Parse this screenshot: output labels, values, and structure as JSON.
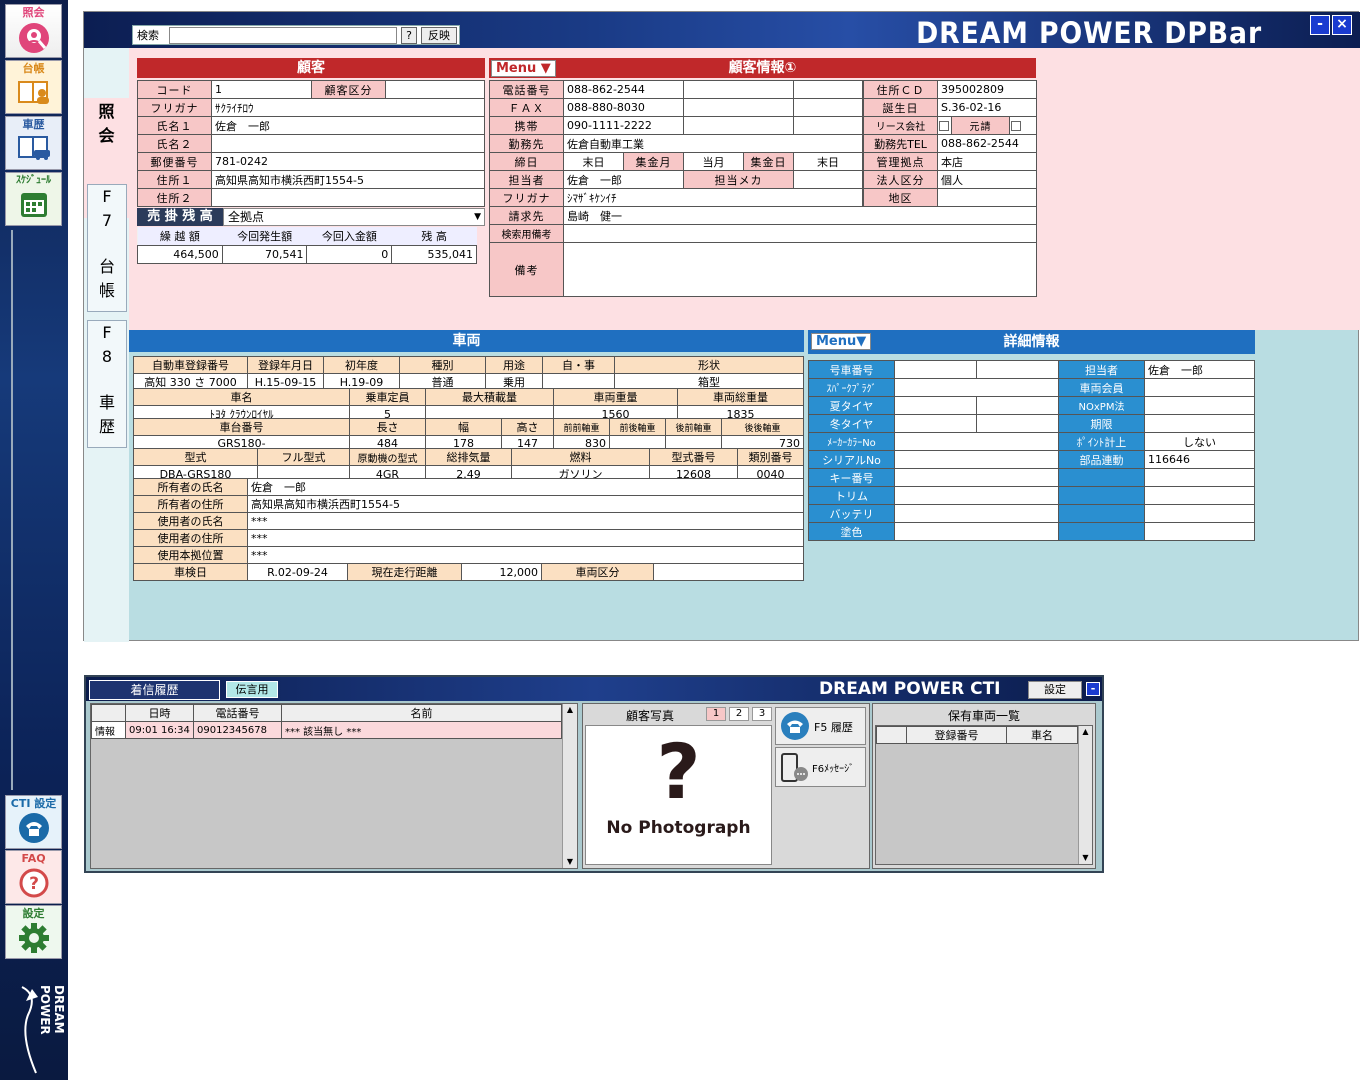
{
  "sidebar": {
    "items": [
      {
        "label": "照会"
      },
      {
        "label": "台帳"
      },
      {
        "label": "車歴"
      },
      {
        "label": "ｽｹｼﾞｭｰﾙ"
      }
    ],
    "bottom": [
      {
        "label": "CTI 設定"
      },
      {
        "label": "FAQ"
      },
      {
        "label": "設定"
      }
    ],
    "brand": "DREAM POWER"
  },
  "window": {
    "title": "DREAM POWER DPBar",
    "search_label": "検索",
    "search_value": "",
    "help_btn": "?",
    "apply_btn": "反映",
    "min_btn": "-",
    "close_btn": "×"
  },
  "tabs": {
    "current": "照会",
    "f7": "F",
    "f7b": "7",
    "f7c": "台",
    "f7d": "帳",
    "f8": "F",
    "f8b": "8",
    "f8c": "車",
    "f8d": "歴",
    "cur1": "照",
    "cur2": "会"
  },
  "customer": {
    "title": "顧客",
    "code_lbl": "コード",
    "code": "1",
    "kubun_lbl": "顧客区分",
    "kubun": "",
    "kana_lbl": "フリガナ",
    "kana": "ｻｸﾗｲﾁﾛｳ",
    "name1_lbl": "氏名１",
    "name1": "佐倉　一郎",
    "name2_lbl": "氏名２",
    "name2": "",
    "zip_lbl": "郵便番号",
    "zip": "781-0242",
    "addr1_lbl": "住所１",
    "addr1": "高知県高知市横浜西町1554-5",
    "addr2_lbl": "住所２",
    "addr2": "",
    "balance_lbl": "売 掛 残 高",
    "balance_scope": "全拠点",
    "carry_lbl": "繰 越 額",
    "cur_lbl": "今回発生額",
    "paid_lbl": "今回入金額",
    "rem_lbl": "残 高",
    "carry": "464,500",
    "cur": "70,541",
    "paid": "0",
    "rem": "535,041"
  },
  "custinfo": {
    "menu": "Menu ▼",
    "title": "顧客情報①",
    "tel_lbl": "電話番号",
    "tel": "088-862-2544",
    "fax_lbl": "ＦＡＸ",
    "fax": "088-880-8030",
    "mobile_lbl": "携帯",
    "mobile": "090-1111-2222",
    "work_lbl": "勤務先",
    "work": "佐倉自動車工業",
    "close_lbl": "締日",
    "close": "末日",
    "collect_m_lbl": "集金月",
    "collect_m": "当月",
    "collect_d_lbl": "集金日",
    "collect_d": "末日",
    "staff_lbl": "担当者",
    "staff": "佐倉　一郎",
    "staff_mk_lbl": "担当メカ",
    "staff_mk": "",
    "kana_lbl": "フリガナ",
    "kana": "ｼﾏｻﾞｷｹﾝｲﾁ",
    "bill_lbl": "請求先",
    "bill": "島崎　健一",
    "search_lbl": "検索用備考",
    "search": "",
    "note_lbl": "備考",
    "note": "",
    "addrcd_lbl": "住所ＣＤ",
    "addrcd": "395002809",
    "birth_lbl": "誕生日",
    "birth": "S.36-02-16",
    "lease_lbl": "リース会社",
    "motouke_lbl": "元請",
    "worktel_lbl": "勤務先TEL",
    "worktel": "088-862-2544",
    "base_lbl": "管理拠点",
    "base": "本店",
    "corp_lbl": "法人区分",
    "corp": "個人",
    "area_lbl": "地区",
    "area": ""
  },
  "vehicle": {
    "title": "車両",
    "reg_lbl": "自動車登録番号",
    "reg": "高知 330 さ 7000",
    "regdate_lbl": "登録年月日",
    "regdate": "H.15-09-15",
    "first_lbl": "初年度",
    "first": "H.19-09",
    "kind_lbl": "種別",
    "kind": "普通",
    "use_lbl": "用途",
    "use": "乗用",
    "jiji_lbl": "自・事",
    "jiji": "",
    "shape_lbl": "形状",
    "shape": "箱型",
    "carname_lbl": "車名",
    "carname": "ﾄﾖﾀ ｸﾗｳﾝﾛｲﾔﾙ",
    "cap_lbl": "乗車定員",
    "cap": "5",
    "load_lbl": "最大積載量",
    "load": "",
    "weight_lbl": "車両重量",
    "weight": "1560",
    "total_lbl": "車両総重量",
    "total": "1835",
    "chassis_lbl": "車台番号",
    "chassis": "GRS180-",
    "len_lbl": "長さ",
    "len": "484",
    "wid_lbl": "幅",
    "wid": "178",
    "hei_lbl": "高さ",
    "hei": "147",
    "ff_lbl": "前前軸重",
    "ff": "830",
    "fr_lbl": "前後軸重",
    "fr": "",
    "rf_lbl": "後前軸重",
    "rf": "",
    "rr_lbl": "後後軸重",
    "rr": "730",
    "model_lbl": "型式",
    "model": "DBA-GRS180",
    "fullmodel_lbl": "フル型式",
    "fullmodel": "",
    "engine_lbl": "原動機の型式",
    "engine": "4GR",
    "disp_lbl": "総排気量",
    "disp": "2.49",
    "fuel_lbl": "燃料",
    "fuel": "ガソリン",
    "typeno_lbl": "型式番号",
    "typeno": "12608",
    "classno_lbl": "類別番号",
    "classno": "0040",
    "owner_lbl": "所有者の氏名",
    "owner": "佐倉　一郎",
    "owneraddr_lbl": "所有者の住所",
    "owneraddr": "高知県高知市横浜西町1554-5",
    "user_lbl": "使用者の氏名",
    "user": "***",
    "useraddr_lbl": "使用者の住所",
    "useraddr": "***",
    "base_lbl": "使用本拠位置",
    "base": "***",
    "inspect_lbl": "車検日",
    "inspect": "R.02-09-24",
    "mileage_lbl": "現在走行距離",
    "mileage": "12,000",
    "vkubun_lbl": "車両区分",
    "vkubun": ""
  },
  "detail": {
    "menu": "Menu▼",
    "title": "詳細情報",
    "rows": [
      {
        "l": "号車番号",
        "v": "",
        "l2": "担当者",
        "v2": "佐倉　一郎"
      },
      {
        "l": "ｽﾊﾟｰｸﾌﾟﾗｸﾞ",
        "v": "",
        "l2": "車両会員",
        "v2": ""
      },
      {
        "l": "夏タイヤ",
        "v": "",
        "l2": "NOxPM法",
        "v2": ""
      },
      {
        "l": "冬タイヤ",
        "v": "",
        "l2": "期限",
        "v2": ""
      },
      {
        "l": "ﾒｰｶｰｶﾗｰNo",
        "v": "",
        "l2": "ﾎﾟｲﾝﾄ計上",
        "v2": "しない"
      },
      {
        "l": "シリアルNo",
        "v": "",
        "l2": "部品連動",
        "v2": "116646"
      },
      {
        "l": "キー番号",
        "v": "",
        "l2": "",
        "v2": ""
      },
      {
        "l": "トリム",
        "v": "",
        "l2": "",
        "v2": ""
      },
      {
        "l": "バッテリ",
        "v": "",
        "l2": "",
        "v2": ""
      },
      {
        "l": "塗色",
        "v": "",
        "l2": "",
        "v2": ""
      }
    ]
  },
  "cti": {
    "title": "DREAM POWER CTI",
    "settings": "設定",
    "min": "-",
    "tab_history": "着信履歴",
    "tab_memo": "伝言用",
    "col_date": "日時",
    "col_tel": "電話番号",
    "col_name": "名前",
    "row_kind": "情報",
    "row_date": "09:01 16:34",
    "row_tel": "09012345678",
    "row_name": "*** 該当無し ***",
    "photo_lbl": "顧客写真",
    "p1": "1",
    "p2": "2",
    "p3": "3",
    "no_photo_mark": "?",
    "no_photo": "No Photograph",
    "f5": "F5 履歴",
    "f6": "F6ﾒｯｾｰｼﾞ",
    "veh_list": "保有車両一覧",
    "col_reg": "登録番号",
    "col_car": "車名"
  }
}
